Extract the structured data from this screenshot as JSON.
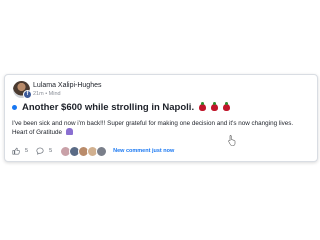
{
  "post": {
    "author": "Lulama Xalipi-Hughes",
    "meta": "21m • Mind",
    "title": "Another $600 while strolling in Napoli.",
    "body_line1": "I've been sick and now i'm back!!! Super grateful for making one decision and it's now changing lives.",
    "body_line2": "Heart of Gratitude",
    "like_count": "5",
    "comment_count": "5",
    "new_comment_label": "New comment just now"
  },
  "colors": {
    "accent": "#1877f2",
    "text": "#1d2129",
    "muted": "#8a8f98"
  },
  "commenter_avatar_colors": [
    "#c9a1a8",
    "#5a6b86",
    "#b98b6a",
    "#d1b08f",
    "#7a7f8a"
  ]
}
